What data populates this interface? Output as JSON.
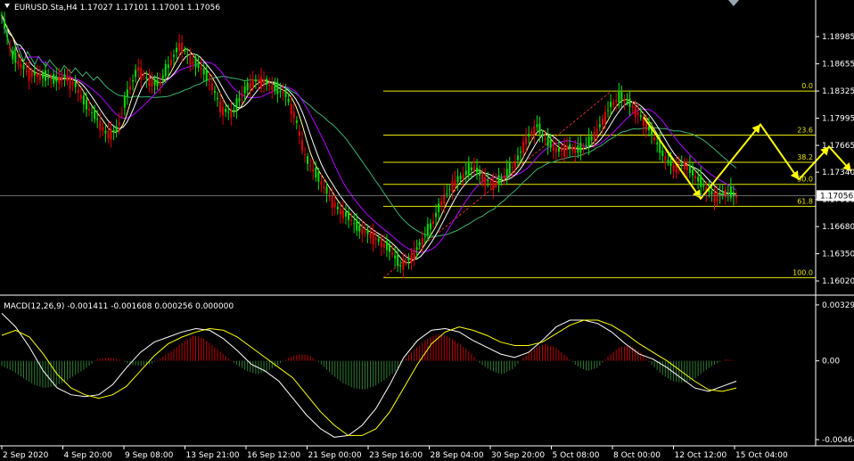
{
  "window": {
    "symbol_header": "EURUSD.Sta,H4  1.17027 1.17101 1.17001 1.17056",
    "macd_header": "MACD(12,26,9) -0.001411 -0.001608 0.000256 0.000000"
  },
  "colors": {
    "background": "#000000",
    "grid_line": "#ffffff",
    "bull_candle": "#00e000",
    "bear_candle": "#e00000",
    "fib": "#e8e800",
    "arrow": "#ffff00",
    "ma_fast": "#ffff99",
    "ma_mid": "#ffffff",
    "ma_slow": "#b000ff",
    "ma_long": "#3cb371",
    "macd_hist_pos": "#c00000",
    "macd_hist_neg": "#2e7d32",
    "macd_main": "#ffffff",
    "macd_signal": "#ffff00"
  },
  "chart_data": {
    "type": "candlestick",
    "price_axis": {
      "ticks": [
        "1.18985",
        "1.18655",
        "1.18325",
        "1.17995",
        "1.17665",
        "1.17340",
        "1.17010",
        "1.16680",
        "1.16350",
        "1.16020"
      ],
      "ylim": [
        1.1588,
        1.193
      ],
      "current_price": "1.17056"
    },
    "time_axis": {
      "labels": [
        "2 Sep 2020",
        "4 Sep 20:00",
        "9 Sep 08:00",
        "13 Sep 21:00",
        "16 Sep 12:00",
        "21 Sep 00:00",
        "23 Sep 16:00",
        "28 Sep 04:00",
        "30 Sep 20:00",
        "5 Oct 08:00",
        "8 Oct 00:00",
        "12 Oct 12:00",
        "15 Oct 04:00"
      ]
    },
    "fibonacci": {
      "high": 1.18325,
      "low": 1.1606,
      "levels": [
        {
          "label": "0.0",
          "ratio": 0.0
        },
        {
          "label": "23.6",
          "ratio": 0.236
        },
        {
          "label": "38.2",
          "ratio": 0.382
        },
        {
          "label": "50.0",
          "ratio": 0.5
        },
        {
          "label": "61.8",
          "ratio": 0.618
        },
        {
          "label": "100.0",
          "ratio": 1.0
        }
      ]
    },
    "price_path": [
      [
        0,
        1.1925
      ],
      [
        2,
        1.1875
      ],
      [
        5,
        1.1855
      ],
      [
        8,
        1.185
      ],
      [
        10,
        1.1845
      ],
      [
        12,
        1.185
      ],
      [
        14,
        1.184
      ],
      [
        16,
        1.1815
      ],
      [
        18,
        1.18
      ],
      [
        20,
        1.178
      ],
      [
        22,
        1.1785
      ],
      [
        24,
        1.183
      ],
      [
        26,
        1.186
      ],
      [
        28,
        1.1845
      ],
      [
        30,
        1.184
      ],
      [
        32,
        1.1865
      ],
      [
        34,
        1.189
      ],
      [
        36,
        1.187
      ],
      [
        38,
        1.186
      ],
      [
        40,
        1.184
      ],
      [
        42,
        1.181
      ],
      [
        44,
        1.1805
      ],
      [
        46,
        1.183
      ],
      [
        48,
        1.1845
      ],
      [
        50,
        1.1845
      ],
      [
        52,
        1.1835
      ],
      [
        54,
        1.183
      ],
      [
        56,
        1.18
      ],
      [
        58,
        1.175
      ],
      [
        60,
        1.173
      ],
      [
        62,
        1.171
      ],
      [
        64,
        1.169
      ],
      [
        66,
        1.168
      ],
      [
        68,
        1.1665
      ],
      [
        70,
        1.166
      ],
      [
        72,
        1.165
      ],
      [
        74,
        1.164
      ],
      [
        76,
        1.162
      ],
      [
        78,
        1.163
      ],
      [
        80,
        1.165
      ],
      [
        82,
        1.167
      ],
      [
        84,
        1.17
      ],
      [
        86,
        1.172
      ],
      [
        88,
        1.173
      ],
      [
        90,
        1.174
      ],
      [
        92,
        1.1725
      ],
      [
        94,
        1.172
      ],
      [
        96,
        1.173
      ],
      [
        98,
        1.1745
      ],
      [
        100,
        1.1775
      ],
      [
        102,
        1.179
      ],
      [
        104,
        1.177
      ],
      [
        106,
        1.176
      ],
      [
        108,
        1.1765
      ],
      [
        110,
        1.176
      ],
      [
        112,
        1.177
      ],
      [
        114,
        1.179
      ],
      [
        116,
        1.1815
      ],
      [
        118,
        1.1825
      ],
      [
        120,
        1.1815
      ],
      [
        122,
        1.18
      ],
      [
        124,
        1.178
      ],
      [
        126,
        1.1755
      ],
      [
        128,
        1.174
      ],
      [
        130,
        1.1745
      ],
      [
        132,
        1.173
      ],
      [
        134,
        1.1715
      ],
      [
        136,
        1.1705
      ],
      [
        138,
        1.171
      ],
      [
        140,
        1.1705
      ]
    ],
    "projection_arrows": [
      {
        "points": [
          [
            722,
            1.1801
          ],
          [
            786,
            1.1702
          ],
          [
            853,
            1.1792
          ],
          [
            896,
            1.1725
          ]
        ]
      },
      {
        "points": [
          [
            896,
            1.1725
          ],
          [
            930,
            1.1765
          ],
          [
            955,
            1.1735
          ]
        ]
      }
    ],
    "macd": {
      "ylim": [
        -0.00485,
        0.00345
      ],
      "ticks": [
        "0.003296",
        "0.00",
        "-0.004641"
      ],
      "histogram": [
        -0.0003,
        -0.0006,
        -0.001,
        -0.0014,
        -0.0016,
        -0.0015,
        -0.0012,
        -0.0008,
        -0.0004,
        0.0001,
        0.0002,
        0.0001,
        -0.0002,
        -0.0003,
        -0.0002,
        0.0002,
        0.0006,
        0.0011,
        0.0015,
        0.0013,
        0.0008,
        0.0003,
        -0.0002,
        -0.0006,
        -0.0008,
        -0.0006,
        -0.0002,
        0.0002,
        0.0004,
        0.0003,
        -0.0002,
        -0.0008,
        -0.0013,
        -0.0016,
        -0.0017,
        -0.0015,
        -0.0011,
        -0.0006,
        0.0002,
        0.0008,
        0.0013,
        0.0016,
        0.0014,
        0.001,
        0.0005,
        -0.0002,
        -0.0006,
        -0.0008,
        -0.0005,
        0.0002,
        0.0007,
        0.001,
        0.0008,
        0.0003,
        -0.0003,
        -0.0006,
        -0.0004,
        0.0003,
        0.0008,
        0.0009,
        0.0005,
        -0.0002,
        -0.0008,
        -0.0012,
        -0.0013,
        -0.0011,
        -0.0006,
        -0.0002,
        0.0001,
        0.0
      ],
      "main": [
        0.0028,
        0.002,
        0.0008,
        -0.0006,
        -0.0016,
        -0.002,
        -0.0021,
        -0.002,
        -0.0014,
        -0.0004,
        0.0005,
        0.0011,
        0.0014,
        0.0017,
        0.0019,
        0.0018,
        0.0013,
        0.0006,
        -0.0002,
        -0.0006,
        -0.0012,
        -0.0022,
        -0.0032,
        -0.004,
        -0.0045,
        -0.0044,
        -0.0038,
        -0.0028,
        -0.0014,
        0.0002,
        0.0012,
        0.0018,
        0.0019,
        0.0017,
        0.0012,
        0.0008,
        0.0004,
        0.0002,
        0.0005,
        0.0012,
        0.002,
        0.0024,
        0.0024,
        0.0022,
        0.0017,
        0.001,
        0.0004,
        0.0001,
        -0.0004,
        -0.001,
        -0.0016,
        -0.0018,
        -0.0015,
        -0.0012
      ],
      "signal": [
        0.0015,
        0.0018,
        0.0014,
        0.0004,
        -0.0008,
        -0.0016,
        -0.002,
        -0.0022,
        -0.002,
        -0.0015,
        -0.0006,
        0.0003,
        0.001,
        0.0014,
        0.0017,
        0.0019,
        0.0018,
        0.0014,
        0.0008,
        0.0002,
        -0.0004,
        -0.001,
        -0.002,
        -0.003,
        -0.0038,
        -0.0044,
        -0.0044,
        -0.004,
        -0.003,
        -0.0016,
        -0.0002,
        0.001,
        0.0017,
        0.002,
        0.0018,
        0.0015,
        0.0011,
        0.0009,
        0.0009,
        0.0011,
        0.0016,
        0.0021,
        0.0024,
        0.0024,
        0.0021,
        0.0016,
        0.001,
        0.0005,
        0.0,
        -0.0006,
        -0.0012,
        -0.0017,
        -0.0018,
        -0.0016
      ]
    }
  }
}
